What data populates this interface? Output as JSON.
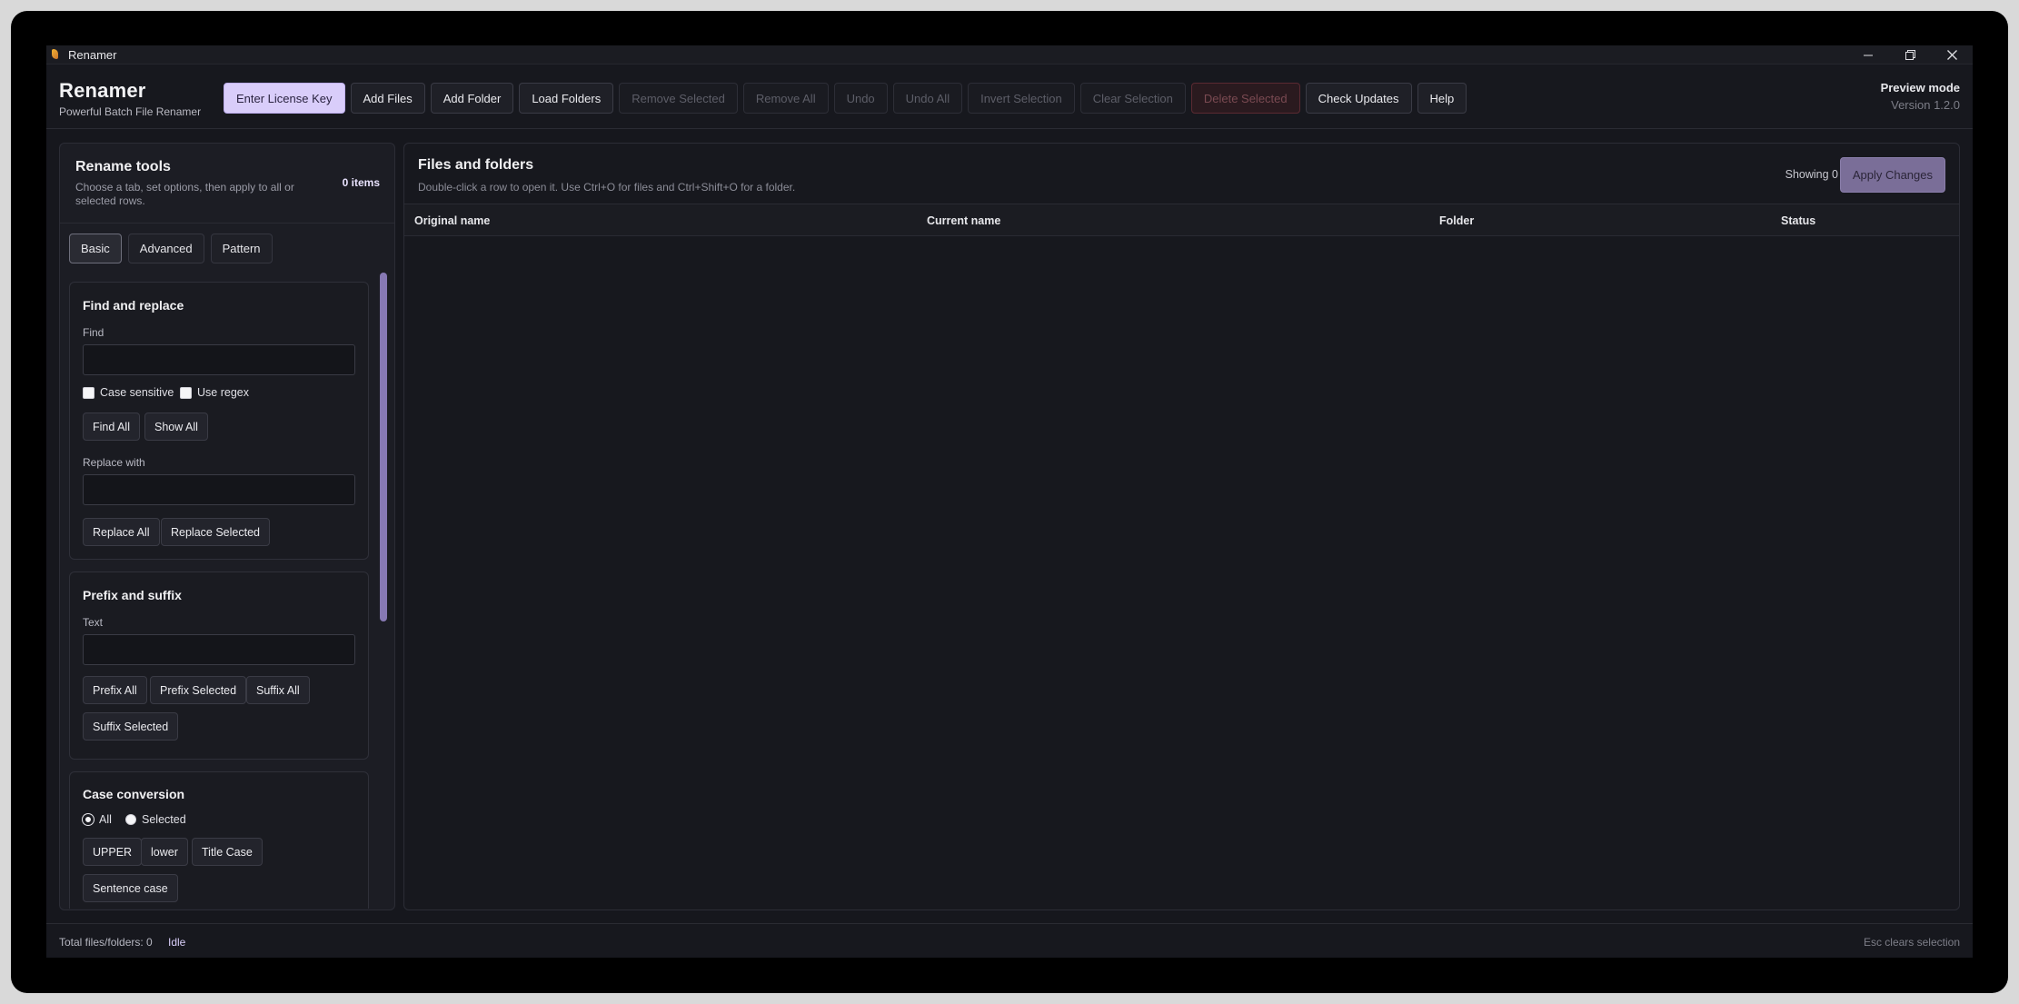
{
  "window": {
    "title": "Renamer"
  },
  "header": {
    "app_name": "Renamer",
    "tagline": "Powerful Batch File Renamer",
    "mode": "Preview mode",
    "version": "Version 1.2.0"
  },
  "toolbar": {
    "enter_license_key": "Enter License Key",
    "add_files": "Add Files",
    "add_folder": "Add Folder",
    "load_folders": "Load Folders",
    "remove_selected": "Remove Selected",
    "remove_all": "Remove All",
    "undo": "Undo",
    "undo_all": "Undo All",
    "invert_selection": "Invert Selection",
    "clear_selection": "Clear Selection",
    "delete_selected": "Delete Selected",
    "check_updates": "Check Updates",
    "help": "Help"
  },
  "tools": {
    "title": "Rename tools",
    "description": "Choose a tab, set options, then apply to all or selected rows.",
    "item_count": "0 items",
    "tabs": [
      "Basic",
      "Advanced",
      "Pattern"
    ],
    "active_tab": "Basic",
    "find_replace": {
      "title": "Find and replace",
      "find_label": "Find",
      "find_value": "",
      "case_sensitive": "Case sensitive",
      "use_regex": "Use regex",
      "find_all": "Find All",
      "show_all": "Show All",
      "replace_label": "Replace with",
      "replace_value": "",
      "replace_all": "Replace All",
      "replace_selected": "Replace Selected"
    },
    "prefix_suffix": {
      "title": "Prefix and suffix",
      "text_label": "Text",
      "text_value": "",
      "prefix_all": "Prefix All",
      "prefix_selected": "Prefix Selected",
      "suffix_all": "Suffix All",
      "suffix_selected": "Suffix Selected"
    },
    "case_conversion": {
      "title": "Case conversion",
      "scope_all": "All",
      "scope_selected": "Selected",
      "selected_scope": "All",
      "upper": "UPPER",
      "lower": "lower",
      "title_case": "Title Case",
      "sentence_case": "Sentence case"
    }
  },
  "files": {
    "title": "Files and folders",
    "description": "Double-click a row to open it. Use Ctrl+O for files and Ctrl+Shift+O for a folder.",
    "showing": "Showing 0",
    "apply_changes": "Apply Changes",
    "columns": [
      "Original name",
      "Current name",
      "Folder",
      "Status"
    ],
    "rows": []
  },
  "status": {
    "total": "Total files/folders: 0",
    "state": "Idle",
    "hint": "Esc clears selection"
  },
  "colors": {
    "accent": "#d9cdfa",
    "background": "#16171d",
    "panel": "#1c1d24"
  }
}
